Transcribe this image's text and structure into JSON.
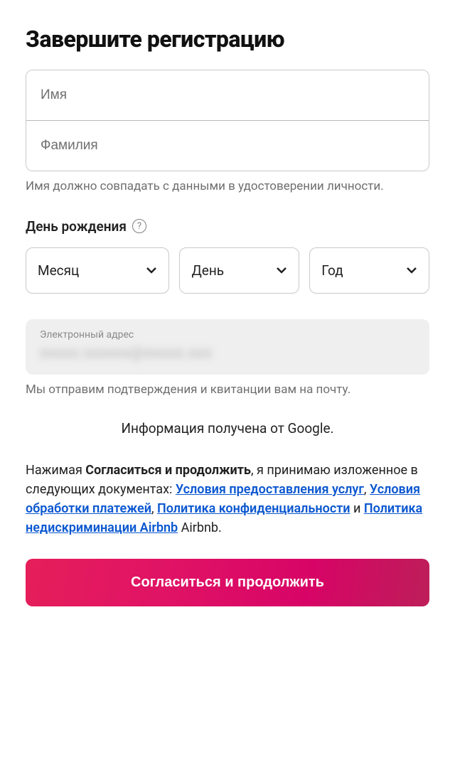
{
  "title": "Завершите регистрацию",
  "name": {
    "first_placeholder": "Имя",
    "last_placeholder": "Фамилия",
    "hint": "Имя должно совпадать с данными в удостоверении личности."
  },
  "birthday": {
    "label": "День рождения",
    "month": "Месяц",
    "day": "День",
    "year": "Год"
  },
  "email": {
    "label": "Электронный адрес",
    "value": "xxxxx.xxxxxx@xxxxx.xxx",
    "hint": "Мы отправим подтверждения и квитанции вам на почту."
  },
  "info_source": "Информация получена от Google.",
  "legal": {
    "prefix": "Нажимая ",
    "bold": "Согласиться и продолжить",
    "after_bold": ", я принимаю изложенное в следующих документах: ",
    "link_tos": "Условия предоставления услуг",
    "sep1": ", ",
    "link_payments": "Условия обработки платежей",
    "sep2": ", ",
    "link_privacy": "Политика конфиденциальности",
    "sep3": " и ",
    "link_nondiscrim": "Политика недискриминации Airbnb",
    "suffix": " Airbnb."
  },
  "submit_label": "Согласиться и продолжить"
}
